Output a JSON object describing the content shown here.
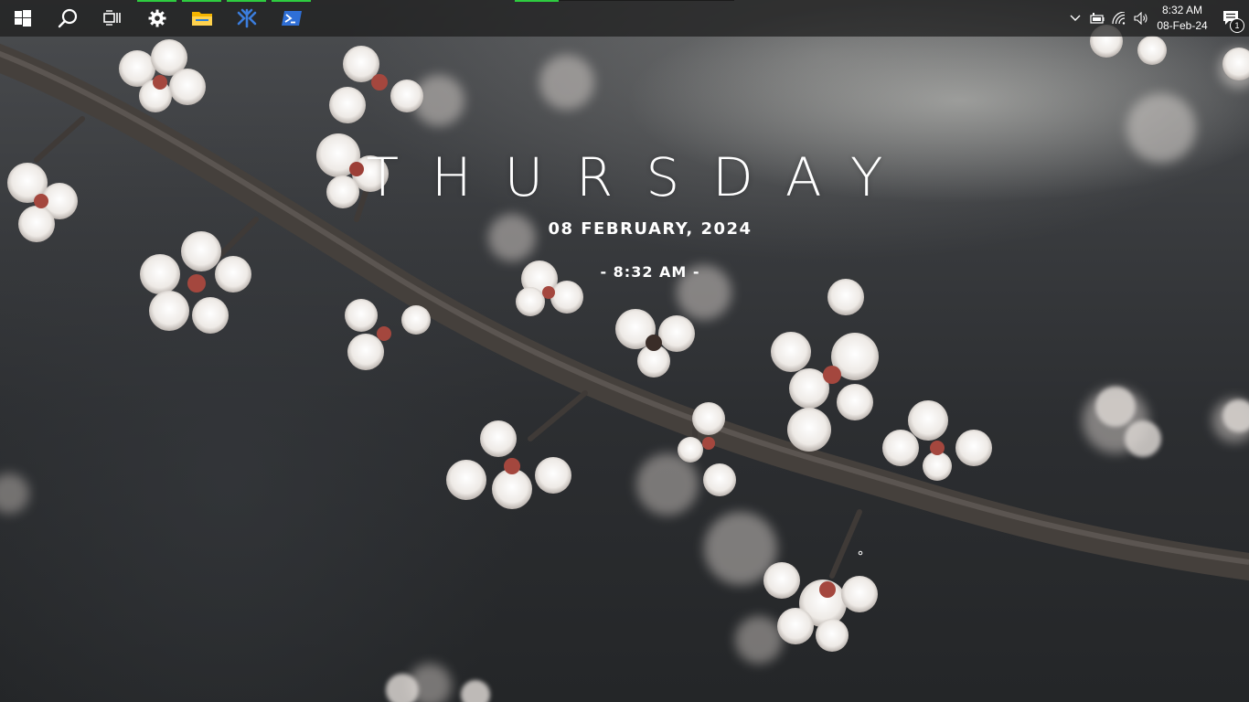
{
  "taskbar": {
    "pinned": [
      {
        "name": "start-button",
        "icon": "windows-logo-icon",
        "active": false
      },
      {
        "name": "search-button",
        "icon": "search-icon",
        "active": false
      },
      {
        "name": "task-view-button",
        "icon": "task-view-icon",
        "active": false
      },
      {
        "name": "settings-button",
        "icon": "gear-icon",
        "active": true
      },
      {
        "name": "file-explorer-button",
        "icon": "folder-icon",
        "active": true
      },
      {
        "name": "vscode-button",
        "icon": "vscode-icon",
        "active": true
      },
      {
        "name": "powershell-button",
        "icon": "powershell-icon",
        "active": true
      }
    ],
    "accent_color": "#2ecc40"
  },
  "tray": {
    "icons": [
      "chevron-up-icon",
      "battery-icon",
      "wifi-icon",
      "volume-icon"
    ],
    "time": "8:32 AM",
    "date": "08-Feb-24",
    "notification_count": "1"
  },
  "widget": {
    "day": "THURSDAY",
    "date": "08 FEBRUARY, 2024",
    "time": "- 8:32 AM -"
  }
}
